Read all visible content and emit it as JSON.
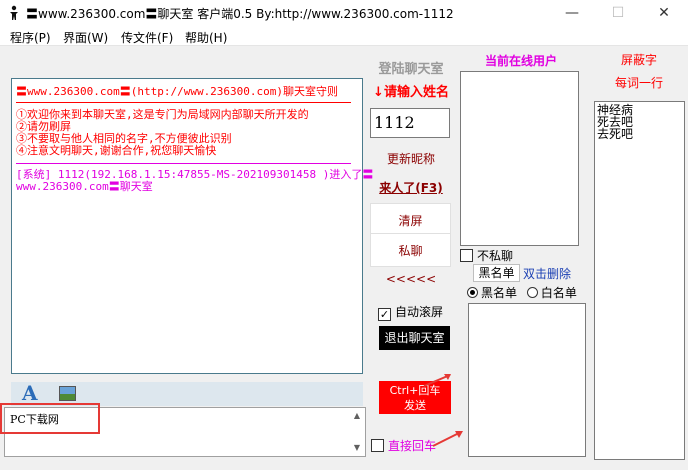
{
  "window": {
    "title": "〓www.236300.com〓聊天室 客户端0.5  By:http://www.236300.com-1112",
    "minimize": "—",
    "maximize": "☐",
    "close": "✕"
  },
  "menu": [
    "程序(P)",
    "界面(W)",
    "传文件(F)",
    "帮助(H)"
  ],
  "chat": {
    "rules_title": "〓www.236300.com〓(http://www.236300.com)聊天室守则",
    "rules": [
      "①欢迎你来到本聊天室,这是专门为局域网内部聊天所开发的",
      "②请勿刷屏",
      "③不要取与他人相同的名字,不方便彼此识别",
      "④注意文明聊天,谢谢合作,祝您聊天愉快"
    ],
    "system_line1": "[系统] 1112(192.168.1.15:47855-MS-202109301458 )进入了〓",
    "system_line2": "www.236300.com〓聊天室"
  },
  "toolbar": {
    "font_icon": "A"
  },
  "input": {
    "value": "PC下载网"
  },
  "login": {
    "title": "登陆聊天室",
    "prompt": "↓请输入姓名",
    "nickname": "1112",
    "rename": "更新昵称",
    "come": "来人了(F3)",
    "clear": "清屏",
    "private": "私聊",
    "arrows": "<<<<<",
    "autoscroll": "自动滚屏",
    "exit": "退出聊天室",
    "send_line1": "Ctrl+回车",
    "send_line2": "发送",
    "direct_enter": "直接回车"
  },
  "online": {
    "title": "当前在线用户",
    "no_private": "不私聊",
    "blacklist": "黑名单",
    "dblclick_delete": "双击删除",
    "radio_black": "黑名单",
    "radio_white": "白名单"
  },
  "blocked": {
    "title": "屏蔽字",
    "subtitle": "每词一行",
    "words": [
      "神经病",
      "死去吧",
      "去死吧"
    ]
  },
  "colors": {
    "accent_red": "#ff0000",
    "accent_magenta": "#e100e1",
    "dark_red": "#8b0000"
  }
}
